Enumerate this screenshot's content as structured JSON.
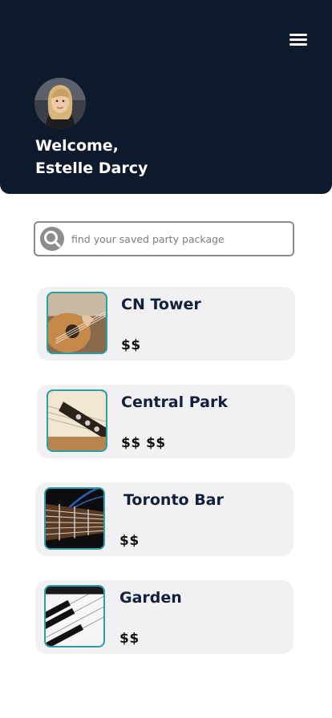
{
  "header": {
    "welcome_line1": "Welcome,",
    "welcome_line2": "Estelle Darcy"
  },
  "search": {
    "placeholder": "find your saved party package"
  },
  "packages": [
    {
      "title": "CN Tower",
      "price": "$$",
      "image": "guitar-icon"
    },
    {
      "title": "Central Park",
      "price": "$$ $$",
      "image": "guitar-headstock-icon"
    },
    {
      "title": "Toronto Bar",
      "price": "$$",
      "image": "guitar-strings-icon"
    },
    {
      "title": "Garden",
      "price": "$$",
      "image": "piano-keys-icon"
    }
  ],
  "colors": {
    "header_bg": "#0c1a2c",
    "card_bg": "#f1f0f3",
    "thumb_border": "#2a9fa8"
  }
}
